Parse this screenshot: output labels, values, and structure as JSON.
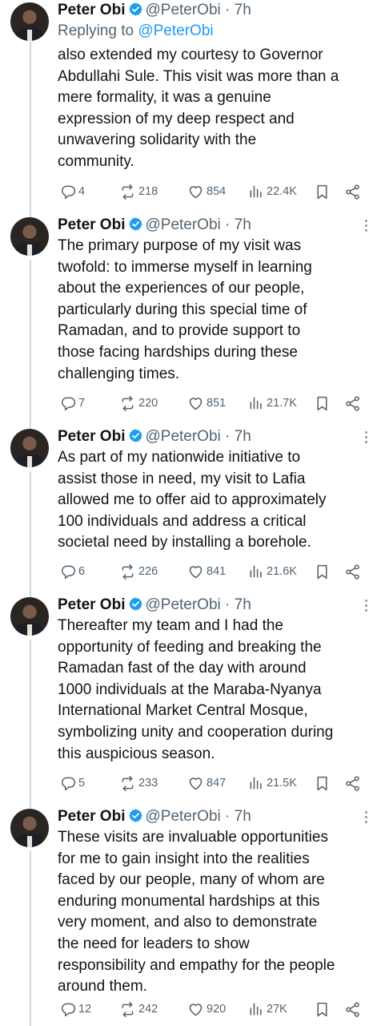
{
  "tweets": [
    {
      "name": "Peter Obi",
      "handle": "@PeterObi",
      "time": "· 7h",
      "replying_prefix": "Replying to ",
      "replying_to": "@PeterObi",
      "text": "also extended my courtesy to Governor\nAbdullahi Sule. This visit was more than a\nmere formality, it was a genuine\nexpression of my deep respect and\nunwavering solidarity with the\ncommunity.",
      "replies": "4",
      "reposts": "218",
      "likes": "854",
      "views": "22.4K"
    },
    {
      "name": "Peter Obi",
      "handle": "@PeterObi",
      "time": "· 7h",
      "text": "The primary purpose of my visit was\ntwofold: to immerse myself in learning\nabout the experiences of our people,\nparticularly during this special time of\nRamadan, and to provide support to\nthose facing hardships during these\nchallenging times.",
      "replies": "7",
      "reposts": "220",
      "likes": "851",
      "views": "21.7K"
    },
    {
      "name": "Peter Obi",
      "handle": "@PeterObi",
      "time": "· 7h",
      "text": "As part of my nationwide initiative to\nassist those in need, my visit to Lafia\nallowed me to offer aid to approximately\n100 individuals and address a critical\nsocietal need by installing a borehole.",
      "replies": "6",
      "reposts": "226",
      "likes": "841",
      "views": "21.6K"
    },
    {
      "name": "Peter Obi",
      "handle": "@PeterObi",
      "time": "· 7h",
      "text": "Thereafter my team and I had the\nopportunity of feeding and breaking the\nRamadan fast of the day with around\n1000 individuals at the Maraba-Nyanya\nInternational Market Central Mosque,\nsymbolizing unity and cooperation during\nthis auspicious season.",
      "replies": "5",
      "reposts": "233",
      "likes": "847",
      "views": "21.5K"
    },
    {
      "name": "Peter Obi",
      "handle": "@PeterObi",
      "time": "· 7h",
      "text": "These visits are invaluable opportunities\nfor me to gain insight into the realities\nfaced by our people, many of whom are\nenduring monumental hardships at this\nvery moment, and also to demonstrate\nthe need for leaders to show\nresponsibility and empathy for the people\naround them.",
      "replies": "12",
      "reposts": "242",
      "likes": "920",
      "views": "27K"
    }
  ],
  "colors": {
    "text": "#0f1419",
    "muted": "#536471",
    "link": "#1d9bf0",
    "verified": "#1d9bf0",
    "thread_line": "#cfd9de"
  },
  "icons": [
    "verified-badge-icon",
    "more-icon",
    "reply-icon",
    "repost-icon",
    "like-icon",
    "views-icon",
    "bookmark-icon",
    "share-icon"
  ]
}
